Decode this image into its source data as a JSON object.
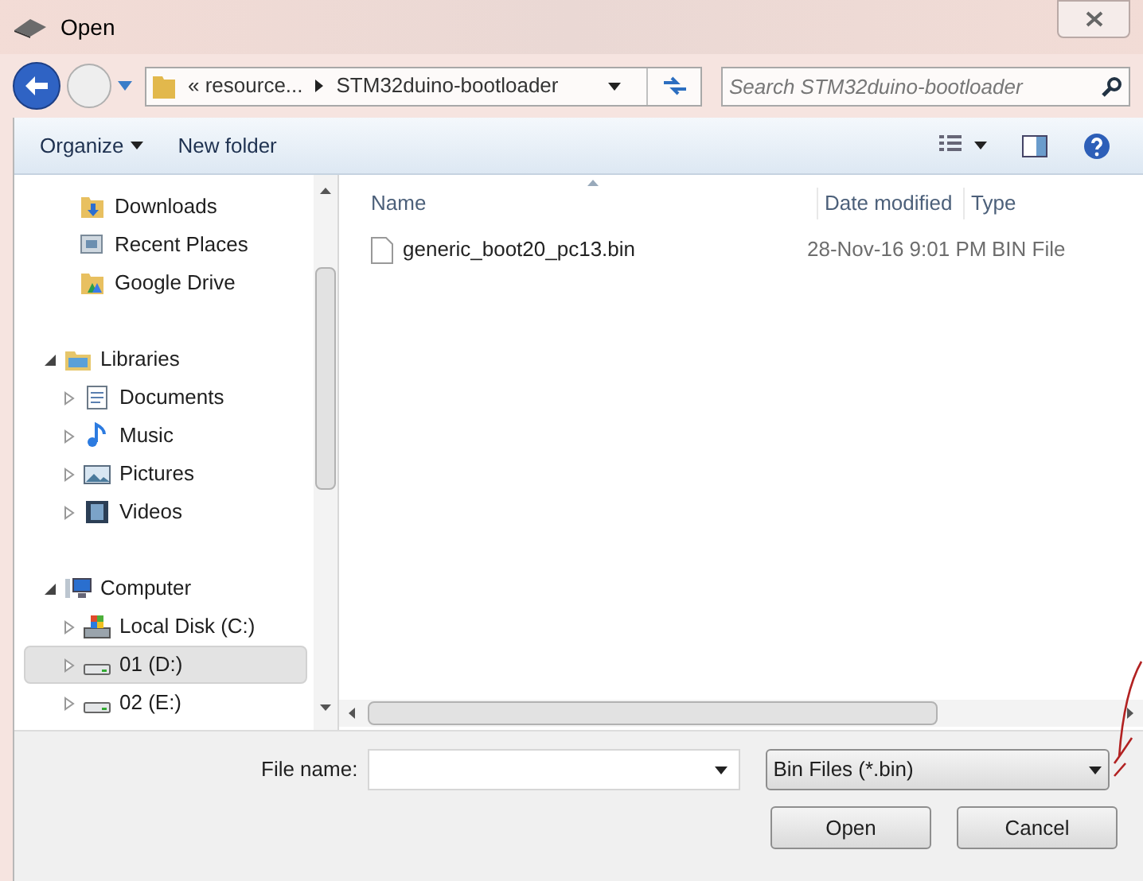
{
  "window": {
    "title": "Open"
  },
  "address": {
    "crumbs": [
      "« resource...",
      "STM32duino-bootloader"
    ]
  },
  "search": {
    "placeholder": "Search STM32duino-bootloader"
  },
  "toolbar": [
    "Organize",
    "New folder"
  ],
  "sidebar": {
    "items": [
      {
        "label": "Downloads",
        "kind": "downloads",
        "selected": false
      },
      {
        "label": "Recent Places",
        "kind": "recent",
        "selected": false
      },
      {
        "label": "Google Drive",
        "kind": "gdrive",
        "selected": false
      },
      {
        "label": "Libraries",
        "kind": "libraries",
        "selected": false,
        "expanded": true,
        "children": [
          {
            "label": "Documents",
            "kind": "documents",
            "selected": false,
            "expanded": false
          },
          {
            "label": "Music",
            "kind": "music",
            "selected": false,
            "expanded": false
          },
          {
            "label": "Pictures",
            "kind": "pictures",
            "selected": false,
            "expanded": false
          },
          {
            "label": "Videos",
            "kind": "videos",
            "selected": false,
            "expanded": false
          }
        ]
      },
      {
        "label": "Computer",
        "kind": "computer",
        "selected": false,
        "expanded": true,
        "children": [
          {
            "label": "Local Disk (C:)",
            "kind": "system",
            "selected": false,
            "expanded": false
          },
          {
            "label": "01 (D:)",
            "kind": "disk",
            "selected": true,
            "expanded": false
          },
          {
            "label": "02 (E:)",
            "kind": "disk",
            "selected": false,
            "expanded": false
          }
        ]
      }
    ]
  },
  "table": {
    "columns": [
      "Name",
      "Date modified",
      "Type"
    ],
    "rows": [
      {
        "cells": [
          "generic_boot20_pc13.bin",
          "28-Nov-16 9:01 PM",
          "BIN File"
        ]
      }
    ]
  },
  "file_name": {
    "label": "File name:"
  },
  "filter": {
    "value": "Bin Files (*.bin)"
  },
  "buttons": [
    "Open",
    "Cancel"
  ]
}
